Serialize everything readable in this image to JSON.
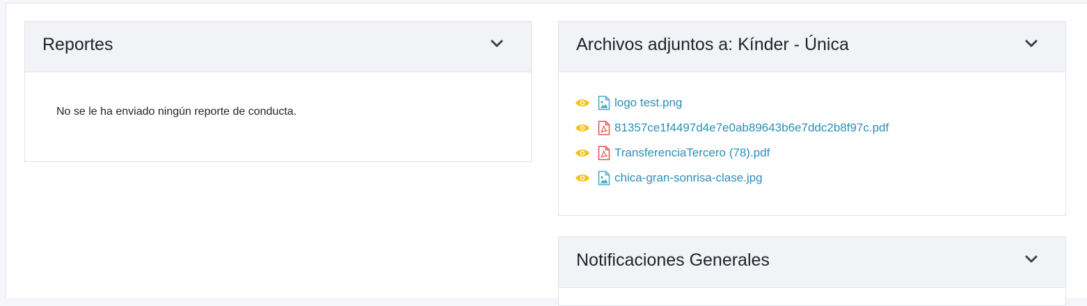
{
  "reportes": {
    "title": "Reportes",
    "empty_message": "No se le ha enviado ningún reporte de conducta."
  },
  "adjuntos": {
    "title": "Archivos adjuntos a: Kínder - Única",
    "files": [
      {
        "name": "logo test.png",
        "icon": "image-file-icon"
      },
      {
        "name": "81357ce1f4497d4e7e0ab89643b6e7ddc2b8f97c.pdf",
        "icon": "pdf-file-icon"
      },
      {
        "name": "TransferenciaTercero (78).pdf",
        "icon": "pdf-file-icon"
      },
      {
        "name": "chica-gran-sonrisa-clase.jpg",
        "icon": "image-file-icon"
      }
    ]
  },
  "notificaciones": {
    "title": "Notificaciones Generales"
  },
  "colors": {
    "link": "#2a8fb8",
    "eye": "#f2c318",
    "pdf": "#e3504a",
    "image": "#4aa8c9",
    "header_bg": "#f1f3f7"
  }
}
